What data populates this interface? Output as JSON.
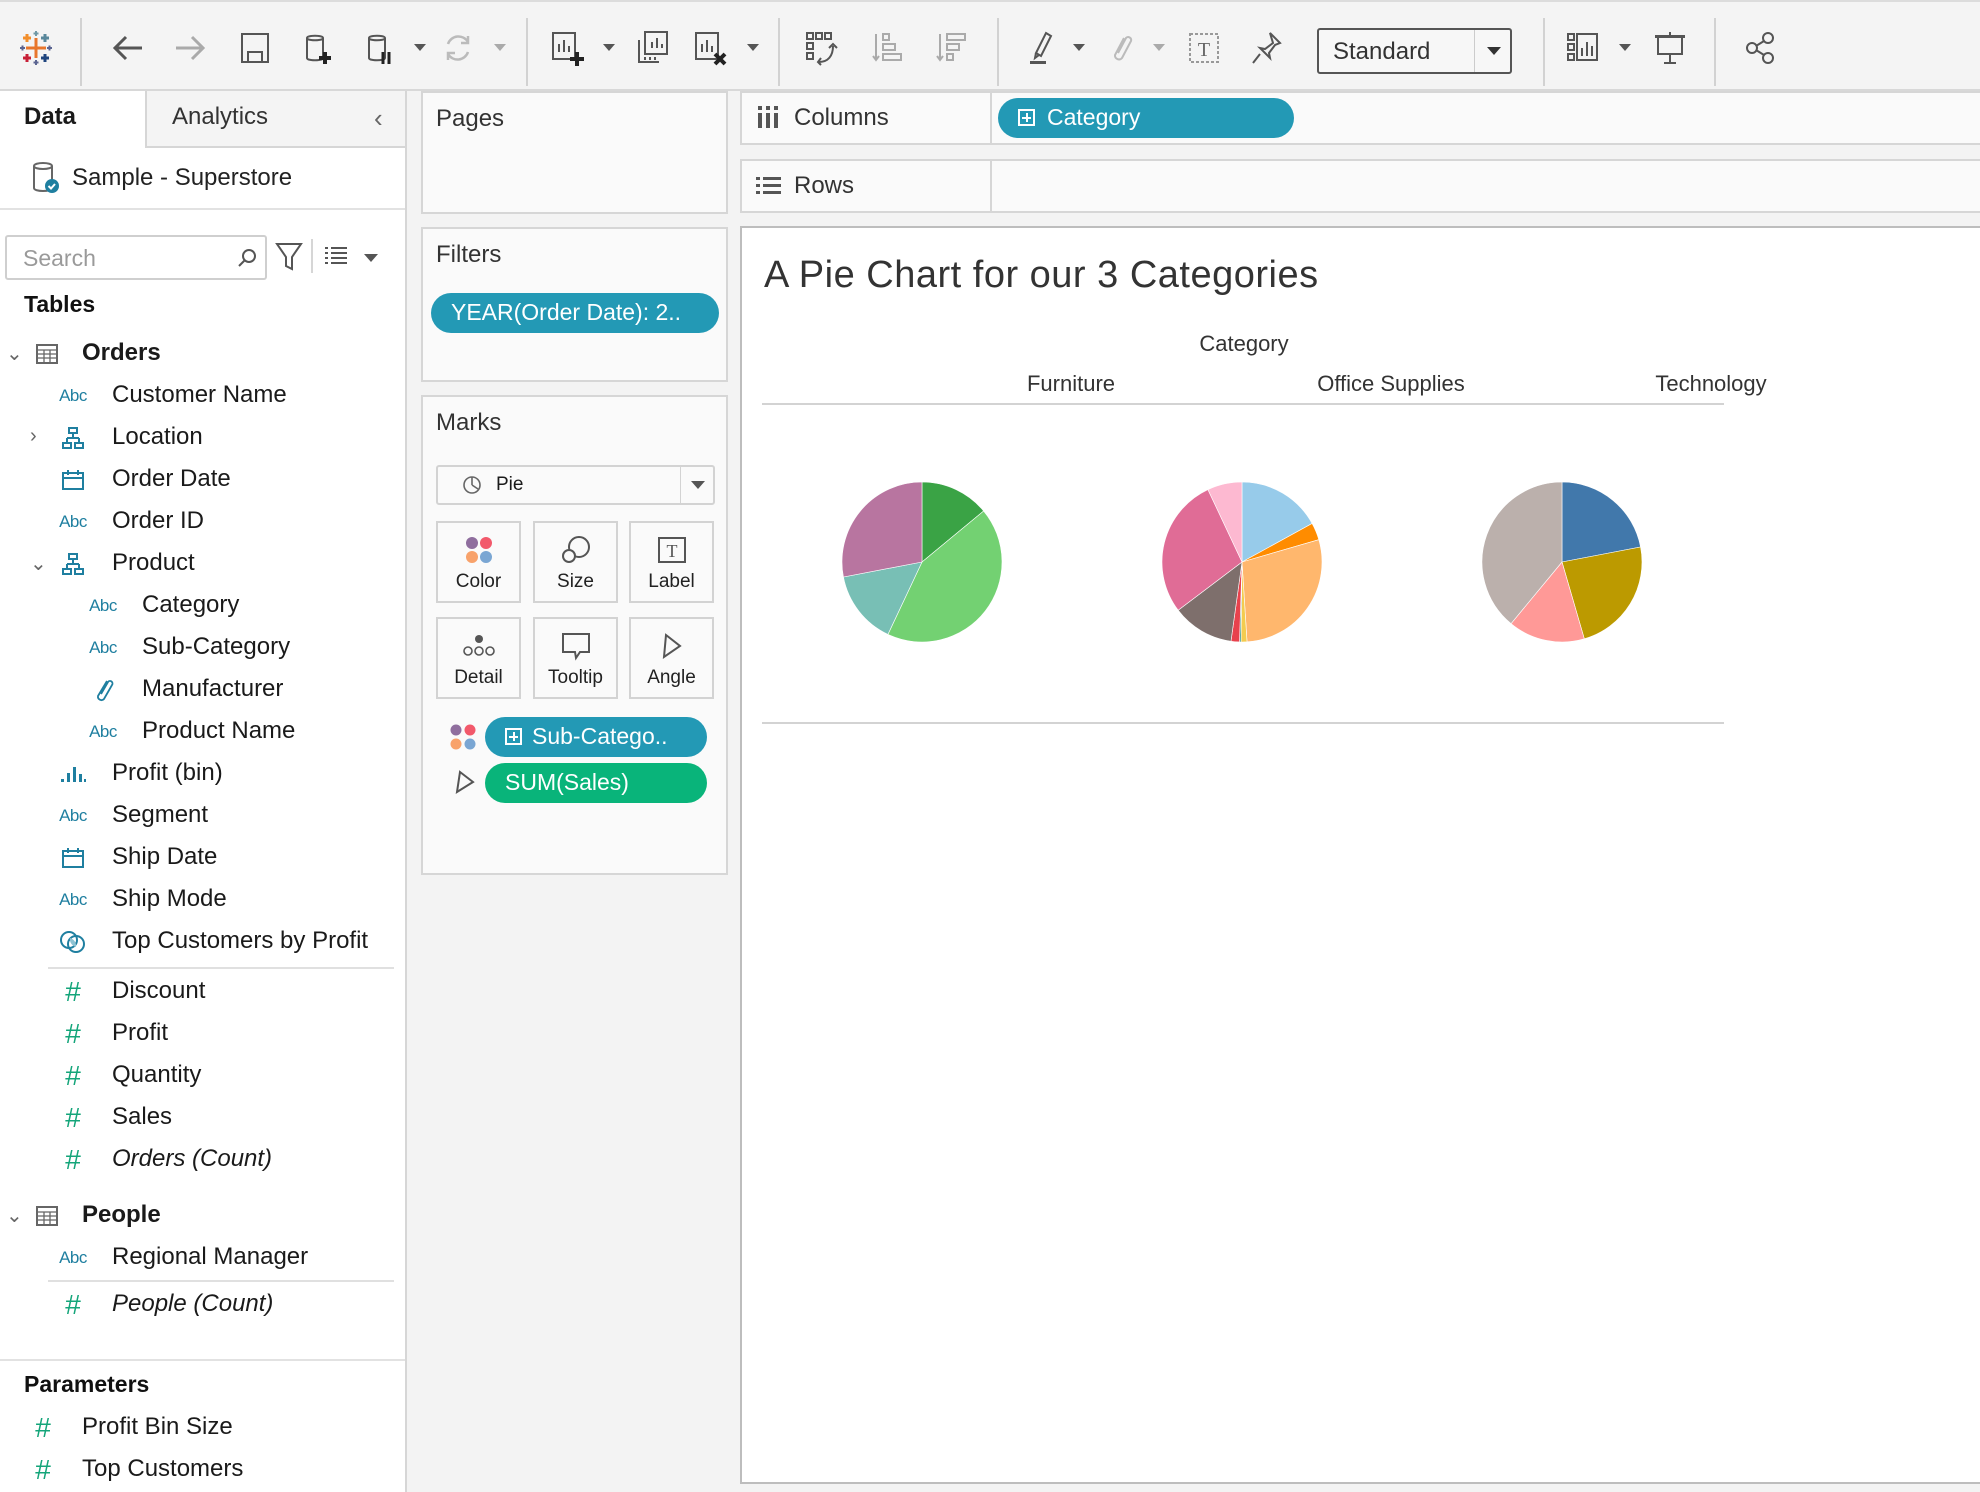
{
  "toolbar": {
    "icons": [
      "tableau-logo-icon",
      "back-icon",
      "forward-icon",
      "save-icon",
      "new-datasource-icon",
      "pause-updates-icon",
      "refresh-icon",
      "new-worksheet-icon",
      "duplicate-sheet-icon",
      "clear-sheet-icon",
      "swap-rows-columns-icon",
      "sort-ascending-icon",
      "sort-descending-icon",
      "highlight-icon",
      "group-icon",
      "show-labels-icon",
      "fix-axes-icon",
      "show-me-icon",
      "presentation-mode-icon",
      "share-icon"
    ],
    "fit_select": "Standard"
  },
  "data_pane": {
    "tabs": [
      {
        "label": "Data",
        "active": true
      },
      {
        "label": "Analytics",
        "active": false
      }
    ],
    "datasource": "Sample - Superstore",
    "search_placeholder": "Search",
    "tables_heading": "Tables",
    "orders": {
      "label": "Orders",
      "fields": [
        {
          "label": "Customer Name",
          "type": "Abc"
        },
        {
          "label": "Location",
          "type": "hierarchy",
          "expand": "collapsed"
        },
        {
          "label": "Order Date",
          "type": "date"
        },
        {
          "label": "Order ID",
          "type": "Abc"
        },
        {
          "label": "Product",
          "type": "hierarchy",
          "expand": "expanded"
        },
        {
          "label": "Category",
          "type": "Abc",
          "indent": true
        },
        {
          "label": "Sub-Category",
          "type": "Abc",
          "indent": true
        },
        {
          "label": "Manufacturer",
          "type": "group",
          "indent": true
        },
        {
          "label": "Product Name",
          "type": "Abc",
          "indent": true
        },
        {
          "label": "Profit (bin)",
          "type": "bin"
        },
        {
          "label": "Segment",
          "type": "Abc"
        },
        {
          "label": "Ship Date",
          "type": "date"
        },
        {
          "label": "Ship Mode",
          "type": "Abc"
        },
        {
          "label": "Top Customers by Profit",
          "type": "set"
        }
      ],
      "measures": [
        {
          "label": "Discount",
          "italic": false
        },
        {
          "label": "Profit",
          "italic": false
        },
        {
          "label": "Quantity",
          "italic": false
        },
        {
          "label": "Sales",
          "italic": false
        },
        {
          "label": "Orders (Count)",
          "italic": true
        }
      ]
    },
    "people": {
      "label": "People",
      "fields": [
        {
          "label": "Regional Manager",
          "type": "Abc"
        }
      ],
      "measures": [
        {
          "label": "People (Count)",
          "italic": true
        }
      ]
    },
    "parameters_heading": "Parameters",
    "parameters": [
      "Profit Bin Size",
      "Top Customers"
    ]
  },
  "cards": {
    "pages": "Pages",
    "filters": "Filters",
    "filter_pill": "YEAR(Order Date): 2..",
    "marks": "Marks",
    "mark_type": "Pie",
    "mark_buttons": [
      "Color",
      "Size",
      "Label",
      "Detail",
      "Tooltip",
      "Angle"
    ],
    "mark_pills": [
      {
        "label": "Sub-Catego..",
        "encoding": "color",
        "color": "#2399b5"
      },
      {
        "label": "SUM(Sales)",
        "encoding": "angle",
        "color": "#09b47a"
      }
    ]
  },
  "shelves": {
    "columns_label": "Columns",
    "columns_pill": "Category",
    "rows_label": "Rows"
  },
  "chart_data": {
    "type": "pie",
    "title": "A Pie Chart for our 3 Categories",
    "header_title": "Category",
    "categories": [
      "Furniture",
      "Office Supplies",
      "Technology"
    ],
    "pies": [
      {
        "category": "Furniture",
        "slices": [
          {
            "share": 14,
            "color": "#3aa345"
          },
          {
            "share": 43,
            "color": "#73d172"
          },
          {
            "share": 15,
            "color": "#78bfb5"
          },
          {
            "share": 28,
            "color": "#b875a0"
          }
        ]
      },
      {
        "category": "Office Supplies",
        "slices": [
          {
            "share": 17,
            "color": "#97cbea"
          },
          {
            "share": 3.5,
            "color": "#ff8c00"
          },
          {
            "share": 28.5,
            "color": "#ffb76d"
          },
          {
            "share": 1.2,
            "color": "#f3cc4f"
          },
          {
            "share": 0.3,
            "color": "#2d8f8f"
          },
          {
            "share": 1.7,
            "color": "#e8424d"
          },
          {
            "share": 12.5,
            "color": "#7e6f6c"
          },
          {
            "share": 28.3,
            "color": "#e06c96"
          },
          {
            "share": 7,
            "color": "#fdb9d1"
          }
        ]
      },
      {
        "category": "Technology",
        "slices": [
          {
            "share": 22,
            "color": "#4178ab"
          },
          {
            "share": 23.5,
            "color": "#bc9a00"
          },
          {
            "share": 15.5,
            "color": "#ff9997"
          },
          {
            "share": 39,
            "color": "#bbb0ac"
          }
        ]
      }
    ],
    "value_field": "SUM(Sales)",
    "color_field": "Sub-Category"
  }
}
